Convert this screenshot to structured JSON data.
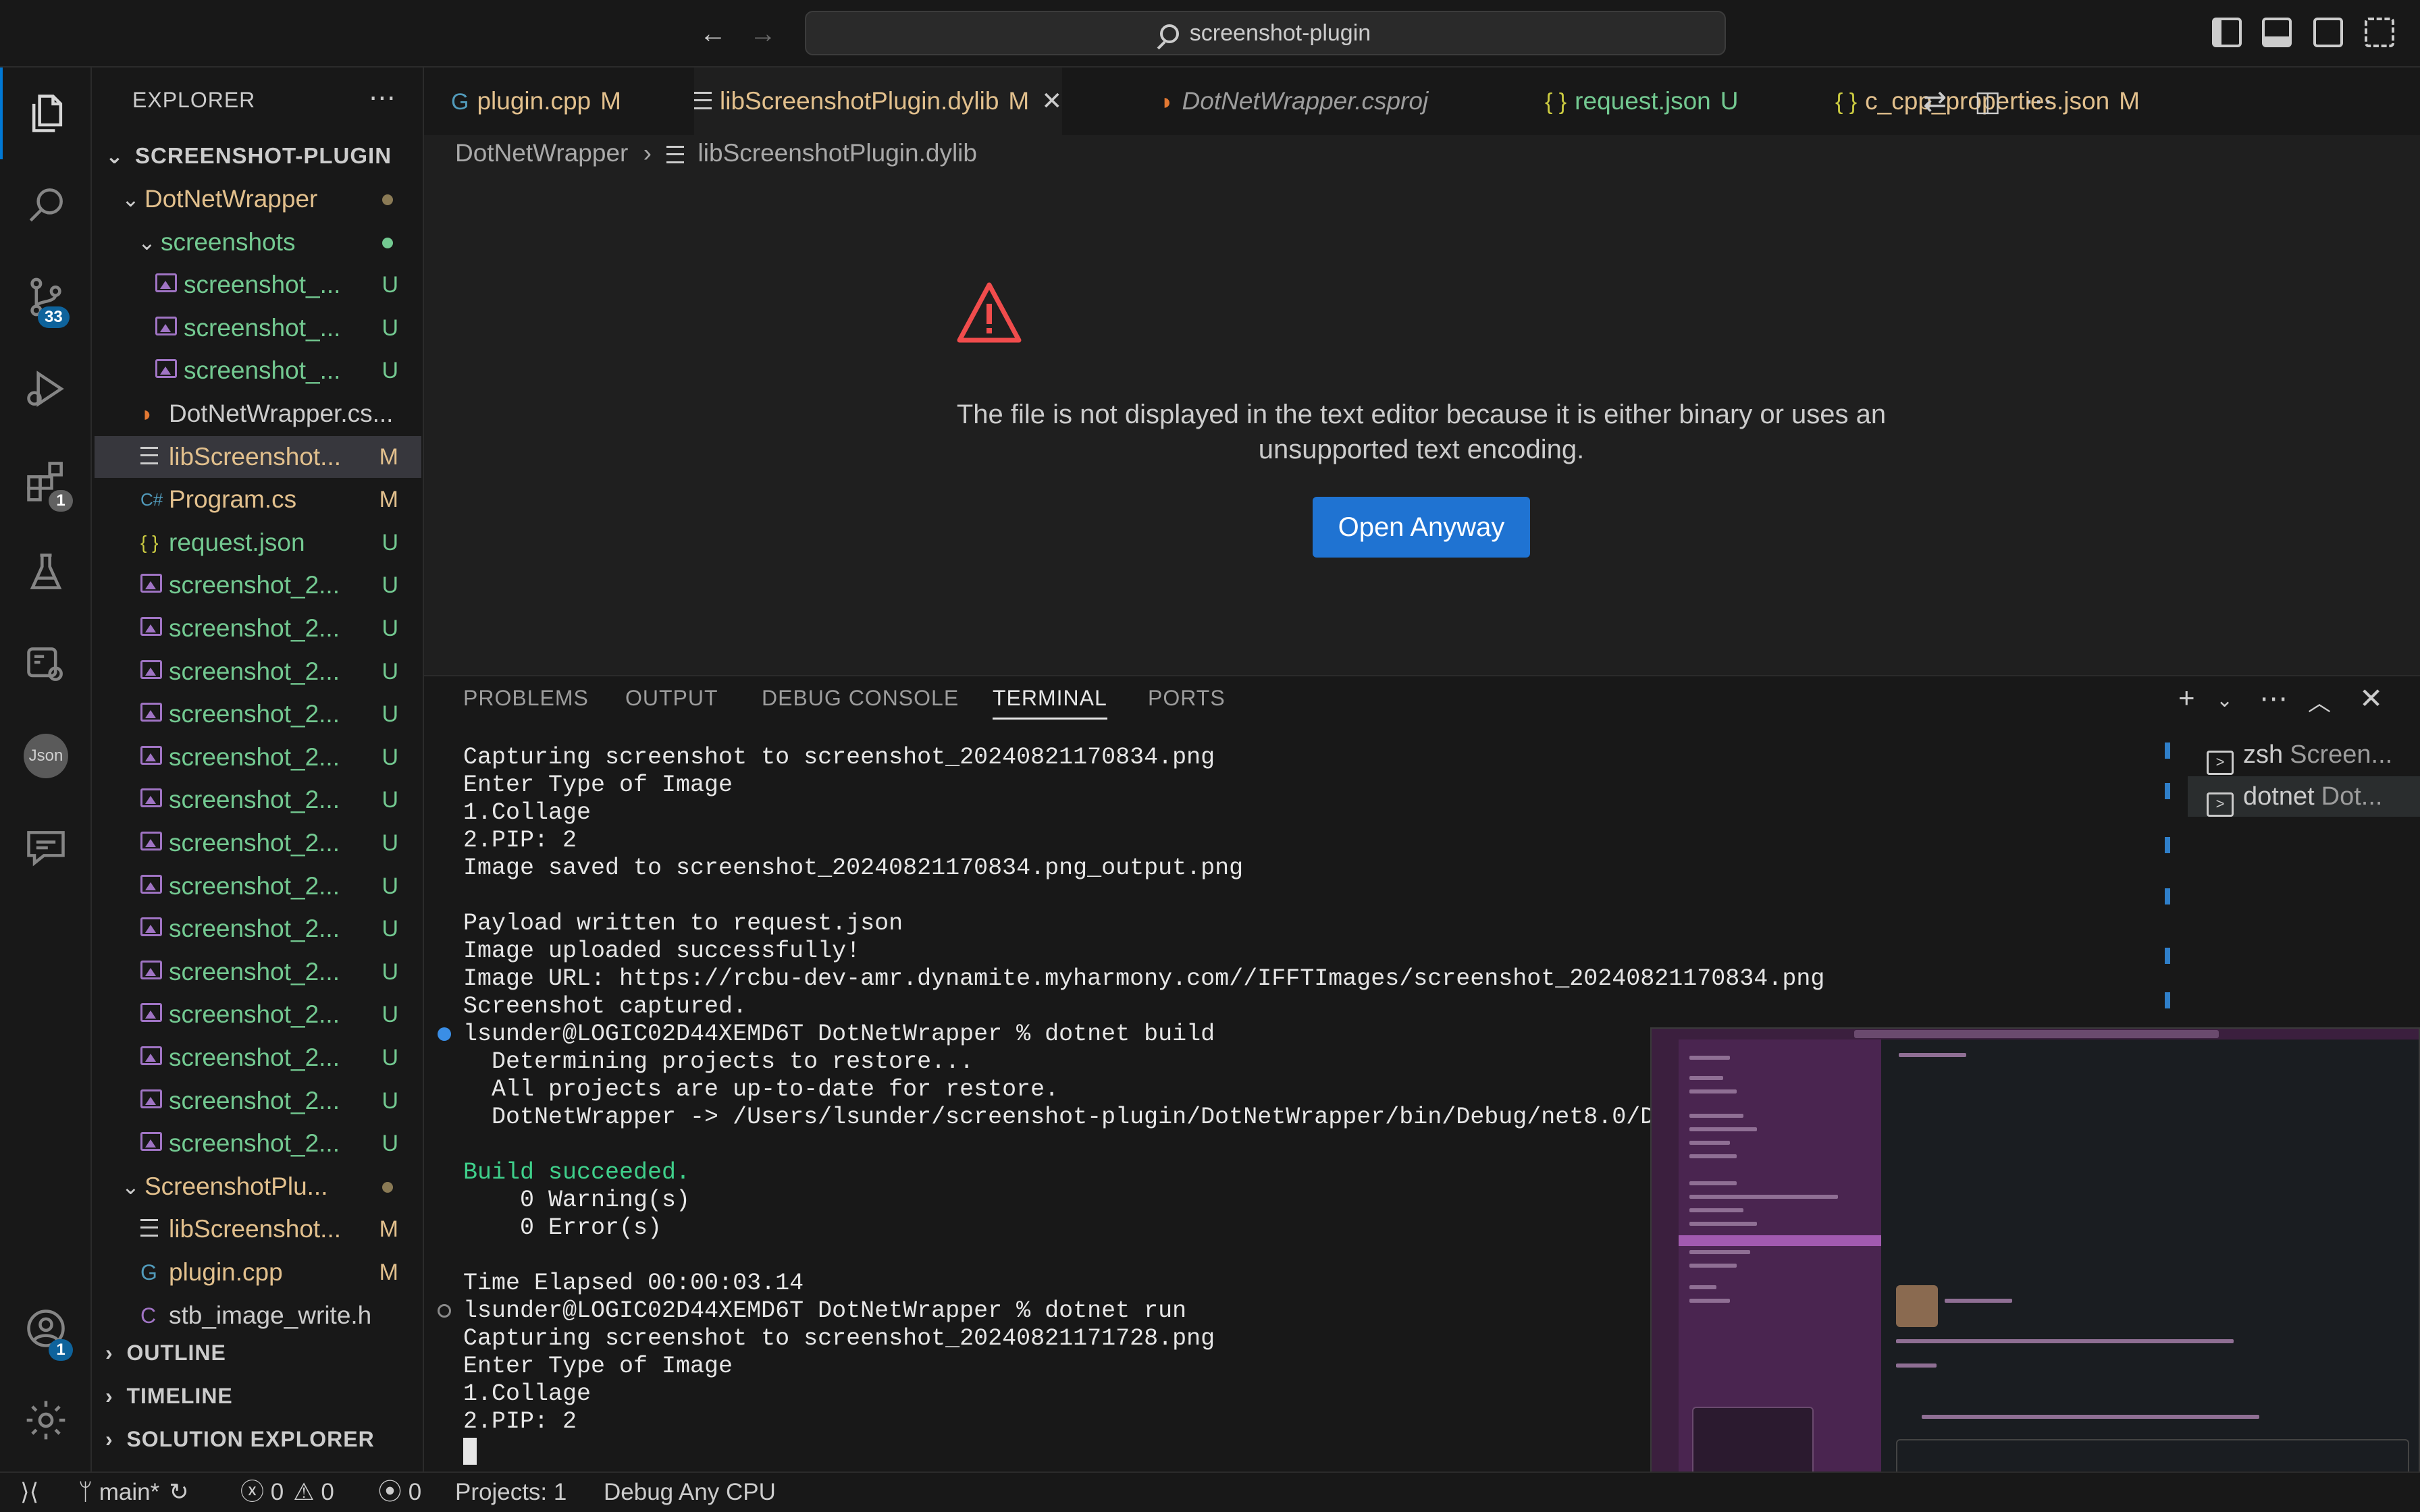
{
  "titlebar": {
    "search_text": "screenshot-plugin"
  },
  "activity_bar": {
    "items": [
      {
        "name": "explorer",
        "icon": "files-icon",
        "active": true
      },
      {
        "name": "search",
        "icon": "search-icon"
      },
      {
        "name": "source-control",
        "icon": "source-control-icon",
        "badge": "33"
      },
      {
        "name": "run-debug",
        "icon": "run-debug-icon"
      },
      {
        "name": "extensions",
        "icon": "extensions-icon",
        "badge": "1"
      },
      {
        "name": "testing",
        "icon": "beaker-icon"
      },
      {
        "name": "remote",
        "icon": "remote-explorer-icon"
      },
      {
        "name": "json",
        "icon": "json-icon",
        "label": "Json"
      },
      {
        "name": "comments",
        "icon": "comments-icon"
      }
    ],
    "account_badge": "1"
  },
  "sidebar": {
    "title": "EXPLORER",
    "root": "SCREENSHOT-PLUGIN",
    "tree": [
      {
        "label": "DotNetWrapper",
        "type": "folder",
        "depth": 1,
        "color": "yellow",
        "dot": true
      },
      {
        "label": "screenshots",
        "type": "folder",
        "depth": 2,
        "color": "green",
        "dot": true
      },
      {
        "label": "screenshot_...",
        "type": "image",
        "depth": 3,
        "color": "green",
        "badge": "U"
      },
      {
        "label": "screenshot_...",
        "type": "image",
        "depth": 3,
        "color": "green",
        "badge": "U"
      },
      {
        "label": "screenshot_...",
        "type": "image",
        "depth": 3,
        "color": "green",
        "badge": "U"
      },
      {
        "label": "DotNetWrapper.cs...",
        "type": "rss",
        "depth": 2,
        "color": "white"
      },
      {
        "label": "libScreenshot...",
        "type": "lines",
        "depth": 2,
        "color": "yellow",
        "badge": "M",
        "selected": true
      },
      {
        "label": "Program.cs",
        "type": "cs",
        "depth": 2,
        "color": "yellow",
        "badge": "M"
      },
      {
        "label": "request.json",
        "type": "json",
        "depth": 2,
        "color": "green",
        "badge": "U"
      },
      {
        "label": "screenshot_2...",
        "type": "image",
        "depth": 2,
        "color": "green",
        "badge": "U"
      },
      {
        "label": "screenshot_2...",
        "type": "image",
        "depth": 2,
        "color": "green",
        "badge": "U"
      },
      {
        "label": "screenshot_2...",
        "type": "image",
        "depth": 2,
        "color": "green",
        "badge": "U"
      },
      {
        "label": "screenshot_2...",
        "type": "image",
        "depth": 2,
        "color": "green",
        "badge": "U"
      },
      {
        "label": "screenshot_2...",
        "type": "image",
        "depth": 2,
        "color": "green",
        "badge": "U"
      },
      {
        "label": "screenshot_2...",
        "type": "image",
        "depth": 2,
        "color": "green",
        "badge": "U"
      },
      {
        "label": "screenshot_2...",
        "type": "image",
        "depth": 2,
        "color": "green",
        "badge": "U"
      },
      {
        "label": "screenshot_2...",
        "type": "image",
        "depth": 2,
        "color": "green",
        "badge": "U"
      },
      {
        "label": "screenshot_2...",
        "type": "image",
        "depth": 2,
        "color": "green",
        "badge": "U"
      },
      {
        "label": "screenshot_2...",
        "type": "image",
        "depth": 2,
        "color": "green",
        "badge": "U"
      },
      {
        "label": "screenshot_2...",
        "type": "image",
        "depth": 2,
        "color": "green",
        "badge": "U"
      },
      {
        "label": "screenshot_2...",
        "type": "image",
        "depth": 2,
        "color": "green",
        "badge": "U"
      },
      {
        "label": "screenshot_2...",
        "type": "image",
        "depth": 2,
        "color": "green",
        "badge": "U"
      },
      {
        "label": "screenshot_2...",
        "type": "image",
        "depth": 2,
        "color": "green",
        "badge": "U"
      },
      {
        "label": "ScreenshotPlu...",
        "type": "folder",
        "depth": 1,
        "color": "yellow",
        "dot": true
      },
      {
        "label": "libScreenshot...",
        "type": "lines",
        "depth": 2,
        "color": "yellow",
        "badge": "M"
      },
      {
        "label": "plugin.cpp",
        "type": "cpp",
        "depth": 2,
        "color": "yellow",
        "badge": "M"
      },
      {
        "label": "stb_image_write.h",
        "type": "c",
        "depth": 2,
        "color": "white"
      }
    ],
    "sections": [
      "OUTLINE",
      "TIMELINE",
      "SOLUTION EXPLORER"
    ]
  },
  "tabs": [
    {
      "label": "plugin.cpp",
      "icon": "G",
      "badge": "M",
      "color": "yellow"
    },
    {
      "label": "libScreenshotPlugin.dylib",
      "icon": "≡",
      "badge": "M",
      "color": "yellow",
      "active": true
    },
    {
      "label": "DotNetWrapper.csproj",
      "icon": "rss",
      "color": "grey"
    },
    {
      "label": "request.json",
      "icon": "{ }",
      "badge": "U",
      "color": "green"
    },
    {
      "label": "c_cpp_properties.json",
      "icon": "{ }",
      "badge": "M",
      "color": "yellow"
    }
  ],
  "breadcrumb": {
    "folder": "DotNetWrapper",
    "file": "libScreenshotPlugin.dylib"
  },
  "editor": {
    "notice": "The file is not displayed in the text editor because it is either binary or uses an unsupported text encoding.",
    "open_anyway": "Open Anyway"
  },
  "panel": {
    "tabs": [
      "PROBLEMS",
      "OUTPUT",
      "DEBUG CONSOLE",
      "TERMINAL",
      "PORTS"
    ],
    "active_tab": "TERMINAL",
    "terminals": [
      {
        "name": "zsh",
        "sub": "Screen..."
      },
      {
        "name": "dotnet",
        "sub": "Dot...",
        "active": true
      }
    ],
    "lines": [
      "Capturing screenshot to screenshot_20240821170834.png",
      "Enter Type of Image",
      "1.Collage",
      "2.PIP: 2",
      "Image saved to screenshot_20240821170834.png_output.png",
      "",
      "Payload written to request.json",
      "Image uploaded successfully!",
      "Image URL: https://rcbu-dev-amr.dynamite.myharmony.com//IFFTImages/screenshot_20240821170834.png",
      "Screenshot captured.",
      "lsunder@LOGIC02D44XEMD6T DotNetWrapper % dotnet build",
      "  Determining projects to restore...",
      "  All projects are up-to-date for restore.",
      "  DotNetWrapper -> /Users/lsunder/screenshot-plugin/DotNetWrapper/bin/Debug/net8.0/DotNe",
      "",
      "Build succeeded.",
      "    0 Warning(s)",
      "    0 Error(s)",
      "",
      "Time Elapsed 00:00:03.14",
      "lsunder@LOGIC02D44XEMD6T DotNetWrapper % dotnet run",
      "Capturing screenshot to screenshot_20240821171728.png",
      "Enter Type of Image",
      "1.Collage",
      "2.PIP: 2"
    ]
  },
  "statusbar": {
    "branch": "main*",
    "errors": "0",
    "warnings": "0",
    "ports": "0",
    "projects": "Projects: 1",
    "config": "Debug Any CPU"
  },
  "colors": {
    "accent": "#0078d4",
    "modified": "#e2c08d",
    "untracked": "#73c991",
    "button": "#1f73d2",
    "warning_icon": "#f14c4c"
  }
}
